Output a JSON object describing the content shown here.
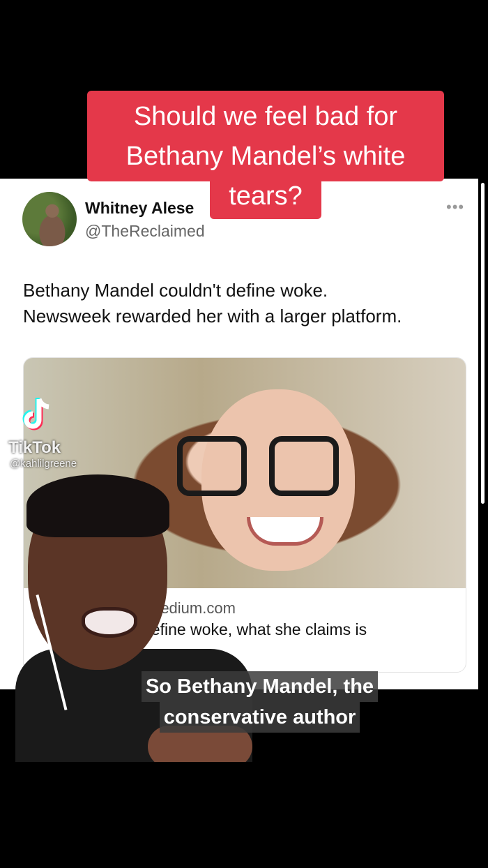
{
  "title_banner": {
    "line1": "Should we feel bad for",
    "line2": "Bethany Mandel’s white",
    "line3": "tears?"
  },
  "tweet": {
    "author_name": "Whitney Alese",
    "author_handle": "@TheReclaimed",
    "more_label": "•••",
    "text_line1": "Bethany Mandel couldn't define woke.",
    "text_line2": "Newsweek rewarded her with a larger platform.",
    "link_domain": "medium.com",
    "link_title": "define woke, what she claims is"
  },
  "tiktok": {
    "brand": "TikTok",
    "username": "@kahlilgreene"
  },
  "caption": {
    "line1": "So Bethany Mandel, the",
    "line2": "conservative author"
  }
}
